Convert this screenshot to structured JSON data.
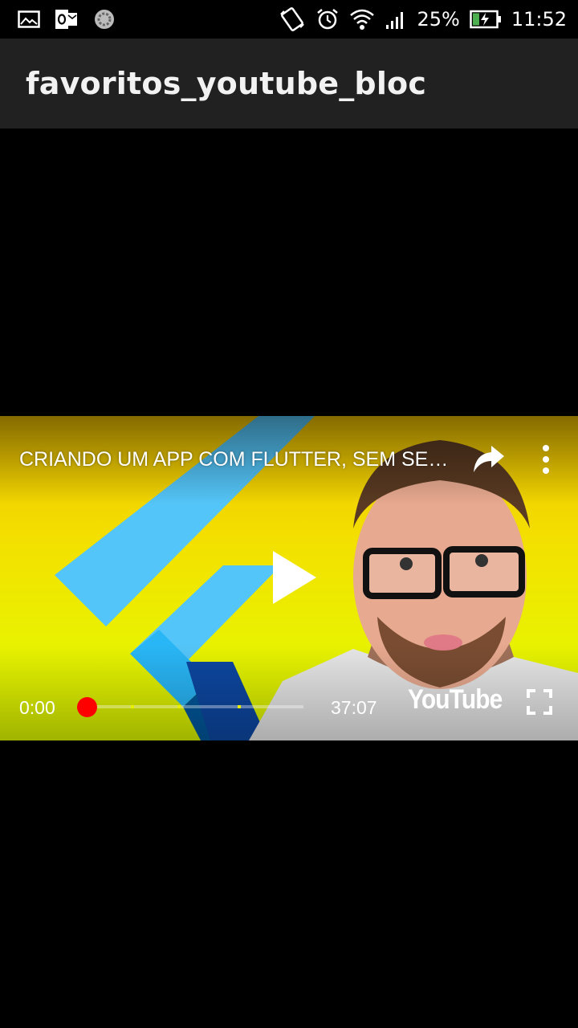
{
  "status_bar": {
    "icons_left": [
      "gallery-icon",
      "outlook-icon",
      "sync-icon"
    ],
    "icons_right": [
      "vibrate-icon",
      "alarm-icon",
      "wifi-icon",
      "signal-icon",
      "battery-charging-icon"
    ],
    "battery_percent": "25%",
    "time": "11:52"
  },
  "app_bar": {
    "title": "favoritos_youtube_bloc",
    "background": "#212121"
  },
  "player": {
    "video_title": "CRIANDO UM APP COM FLUTTER, SEM SERVIDOR",
    "current_time": "0:00",
    "total_time": "37:07",
    "progress_fraction": 0,
    "brand": "YouTube",
    "accent_color": "#ff0000",
    "controls": [
      "share-icon",
      "more-vert-icon",
      "play-icon",
      "fullscreen-icon"
    ]
  }
}
